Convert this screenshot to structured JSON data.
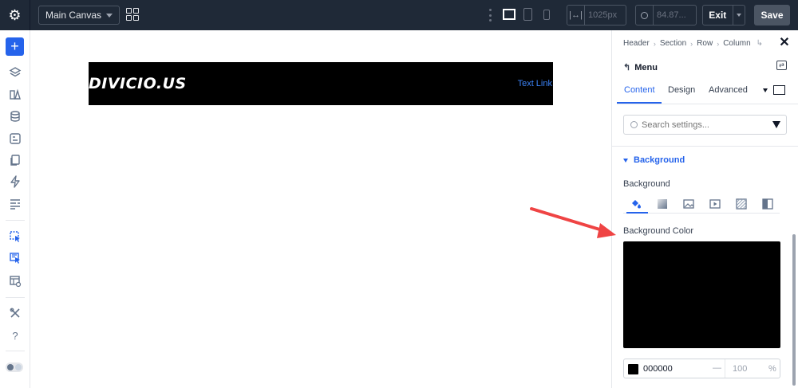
{
  "topbar": {
    "canvas_select": "Main Canvas",
    "width_value": "1025px",
    "zoom_value": "84.87...",
    "exit_label": "Exit",
    "save_label": "Save"
  },
  "canvas": {
    "logo_text": "DIVICIO.US",
    "text_link": "Text Link"
  },
  "panel": {
    "breadcrumb": [
      "Header",
      "Section",
      "Row",
      "Column"
    ],
    "module_title": "Menu",
    "tabs": [
      {
        "label": "Content",
        "active": true
      },
      {
        "label": "Design",
        "active": false
      },
      {
        "label": "Advanced",
        "active": false
      }
    ],
    "search_placeholder": "Search settings...",
    "section_title": "Background",
    "background_label": "Background",
    "background_types": [
      "color-fill-icon",
      "gradient-icon",
      "image-icon",
      "video-icon",
      "pattern-icon",
      "mask-icon"
    ],
    "color_label": "Background Color",
    "hex_value": "000000",
    "opacity_value": "100",
    "opacity_unit": "%",
    "selected_color": "#000000"
  },
  "colors": {
    "accent": "#2563eb",
    "topbar_bg": "#1f2937",
    "annotation_arrow": "#ef4444"
  }
}
